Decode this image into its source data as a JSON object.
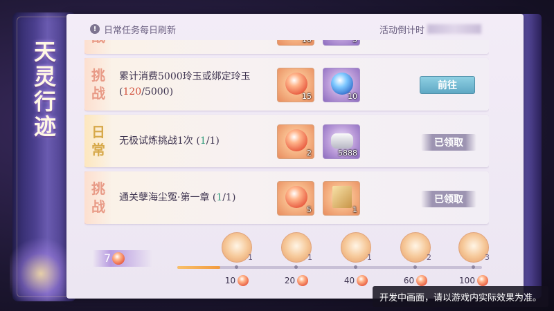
{
  "banner": {
    "title": "天灵行迹"
  },
  "notice": {
    "text": "日常任务每日刷新",
    "countdown_label": "活动倒计时"
  },
  "tags": {
    "challenge": [
      "挑",
      "战"
    ],
    "daily": [
      "日",
      "常"
    ]
  },
  "tasks": [
    {
      "tag": "challenge",
      "text": "累计消费5000玲玉或绑定玲玉",
      "progress_current": "120",
      "progress_total": "5000",
      "progress_state": "incomplete",
      "rewards": [
        {
          "icon": "peach-fruit-icon",
          "count": "15"
        },
        {
          "icon": "blue-orb-icon",
          "count": "10"
        }
      ],
      "button": "前往",
      "button_state": "go"
    },
    {
      "tag": "daily",
      "text": "无极试炼挑战1次",
      "progress_current": "1",
      "progress_total": "1",
      "progress_state": "complete",
      "rewards": [
        {
          "icon": "peach-fruit-icon",
          "count": "2"
        },
        {
          "icon": "silver-ingot-icon",
          "count": "5888"
        }
      ],
      "button": "已领取",
      "button_state": "claimed"
    },
    {
      "tag": "challenge",
      "text": "通关孽海尘冤·第一章",
      "progress_current": "1",
      "progress_total": "1",
      "progress_state": "complete",
      "rewards": [
        {
          "icon": "peach-fruit-icon",
          "count": "5"
        },
        {
          "icon": "golden-scroll-icon",
          "count": "1"
        }
      ],
      "button": "已领取",
      "button_state": "claimed"
    }
  ],
  "partial_task": {
    "rewards": [
      {
        "count": "10"
      },
      {
        "count": "5"
      }
    ]
  },
  "progress": {
    "points": "7",
    "fill_fraction": 0.14,
    "milestones": [
      {
        "threshold": "10",
        "chest_count": "1"
      },
      {
        "threshold": "20",
        "chest_count": "1"
      },
      {
        "threshold": "40",
        "chest_count": "1"
      },
      {
        "threshold": "60",
        "chest_count": "2"
      },
      {
        "threshold": "100",
        "chest_count": "3"
      }
    ]
  },
  "disclaimer": "开发中画面，请以游戏内实际效果为准。"
}
